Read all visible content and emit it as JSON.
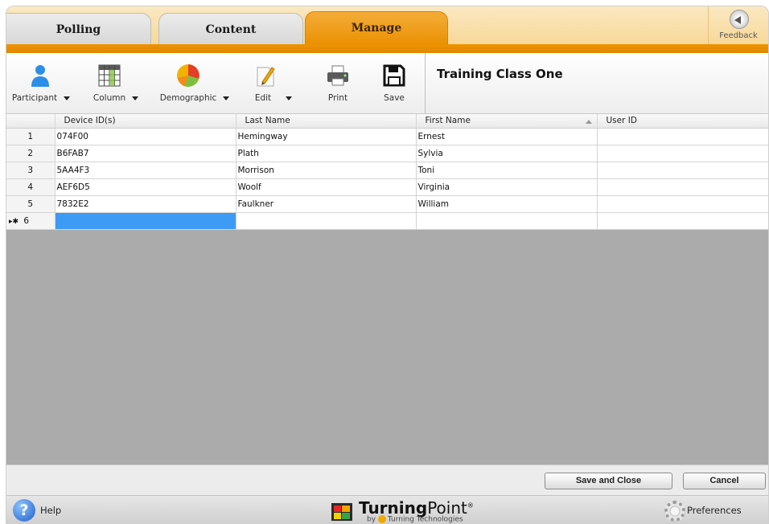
{
  "tabs": [
    {
      "label": "Polling"
    },
    {
      "label": "Content"
    },
    {
      "label": "Manage"
    }
  ],
  "feedback": {
    "label": "Feedback",
    "icon": "speaker-icon"
  },
  "toolbar": {
    "participant": "Participant",
    "column": "Column",
    "demographic": "Demographic",
    "edit": "Edit",
    "print": "Print",
    "save": "Save"
  },
  "class_title": "Training Class One",
  "grid": {
    "columns": [
      "Device ID(s)",
      "Last Name",
      "First Name",
      "User ID"
    ],
    "rows": [
      {
        "num": "1",
        "device_id": "074F00",
        "last_name": "Hemingway",
        "first_name": "Ernest",
        "user_id": ""
      },
      {
        "num": "2",
        "device_id": "B6FAB7",
        "last_name": "Plath",
        "first_name": "Sylvia",
        "user_id": ""
      },
      {
        "num": "3",
        "device_id": "5AA4F3",
        "last_name": "Morrison",
        "first_name": "Toni",
        "user_id": ""
      },
      {
        "num": "4",
        "device_id": "AEF6D5",
        "last_name": "Woolf",
        "first_name": "Virginia",
        "user_id": ""
      },
      {
        "num": "5",
        "device_id": "7832E2",
        "last_name": "Faulkner",
        "first_name": "William",
        "user_id": ""
      }
    ],
    "new_row": {
      "marker": "▸✱",
      "num": "6"
    }
  },
  "actions": {
    "save_close": "Save and Close",
    "cancel": "Cancel"
  },
  "footer": {
    "help": "Help",
    "logo_bold": "Turning",
    "logo_rest": "Point",
    "logo_reg": "®",
    "logo_sub": "by",
    "logo_sub_rest": "Turning Technologies",
    "preferences": "Preferences"
  },
  "colors": {
    "accent": "#ea9000",
    "selected_cell": "#3d9af5",
    "background_empty": "#ababab"
  }
}
